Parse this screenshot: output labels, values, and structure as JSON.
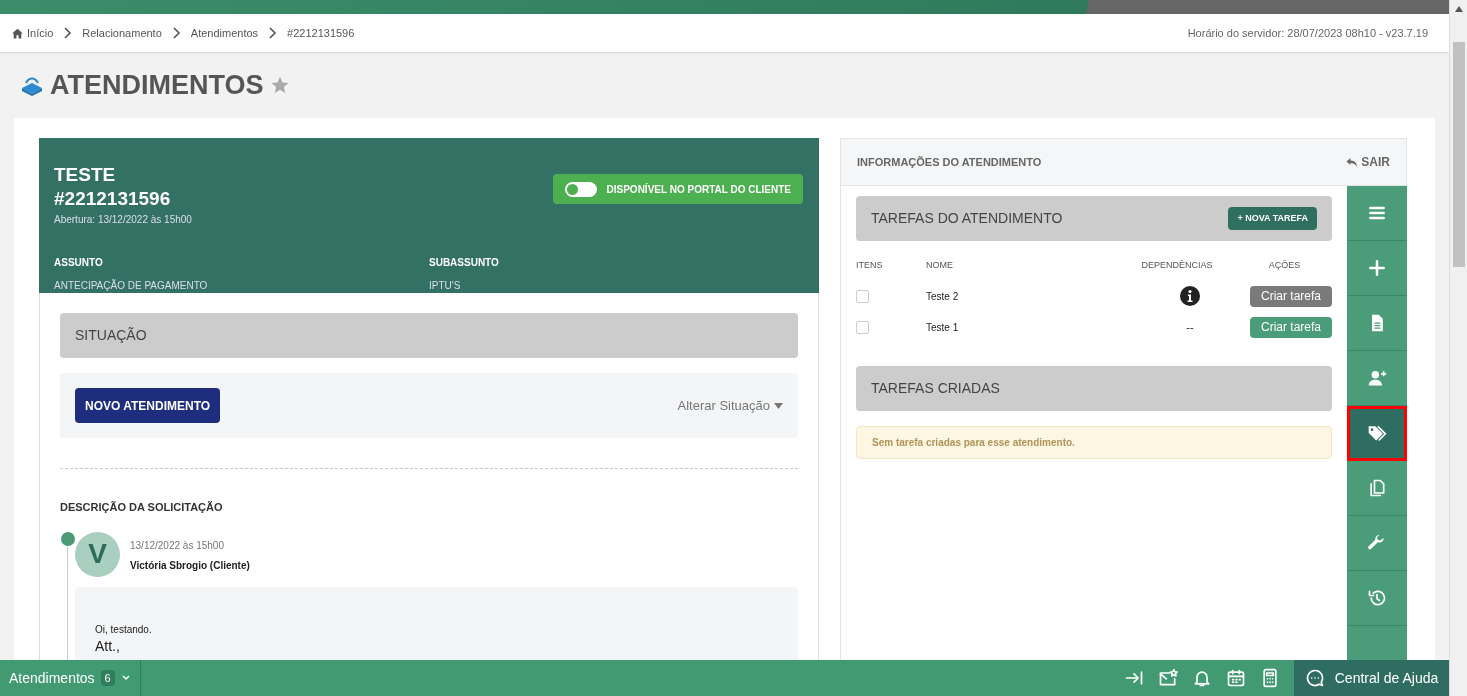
{
  "breadcrumb": [
    {
      "label": "Início",
      "kind": "home"
    },
    {
      "label": "Relacionamento"
    },
    {
      "label": "Atendimentos"
    },
    {
      "label": "#2212131596"
    }
  ],
  "server_info": "Horário do servidor: 28/07/2023 08h10 - v23.7.19",
  "page_title": "ATENDIMENTOS",
  "favorite": false,
  "ticket": {
    "title": "TESTE",
    "number": "#2212131596",
    "opened": "Abertura: 13/12/2022 às 15h00",
    "portal_toggle": {
      "label": "DISPONÍVEL NO PORTAL DO CLIENTE",
      "on": false
    },
    "fields": [
      {
        "label": "ASSUNTO",
        "value": "ANTECIPAÇÃO DE PAGAMENTO"
      },
      {
        "label": "SUBASSUNTO",
        "value": "IPTU'S"
      }
    ]
  },
  "situation": {
    "title": "SITUAÇÃO",
    "button": "NOVO ATENDIMENTO",
    "dropdown": "Alterar Situação"
  },
  "description": {
    "title": "DESCRIÇÃO DA SOLICITAÇÃO",
    "entry": {
      "initial": "V",
      "date": "13/12/2022 às 15h00",
      "author": "Victória Sbrogio (Cliente)",
      "lines": [
        "Oi, testando.",
        "Att.,"
      ]
    }
  },
  "info_panel": {
    "title": "INFORMAÇÕES DO ATENDIMENTO",
    "exit": "SAIR",
    "tasks": {
      "title": "TAREFAS DO ATENDIMENTO",
      "new_button": "+ NOVA TAREFA",
      "columns": [
        "ITENS",
        "NOME",
        "DEPENDÊNCIAS",
        "AÇÕES"
      ],
      "rows": [
        {
          "checked": false,
          "name": "Teste 2",
          "dependency": {
            "kind": "info"
          },
          "action": "Criar tarefa",
          "disabled": true
        },
        {
          "checked": false,
          "name": "Teste 1",
          "dependency": {
            "kind": "text",
            "text": "--"
          },
          "action": "Criar tarefa",
          "disabled": false
        }
      ]
    },
    "created": {
      "title": "TAREFAS CRIADAS",
      "empty_message": "Sem tarefa criadas para esse atendimento."
    },
    "toolbar": [
      {
        "selected": false
      },
      {
        "selected": false
      },
      {
        "selected": false
      },
      {
        "selected": false
      },
      {
        "selected": true
      },
      {
        "selected": false
      },
      {
        "selected": false
      },
      {
        "selected": false
      }
    ]
  },
  "bottom_bar": {
    "label": "Atendimentos",
    "count": "6",
    "help": "Central de Ajuda"
  }
}
